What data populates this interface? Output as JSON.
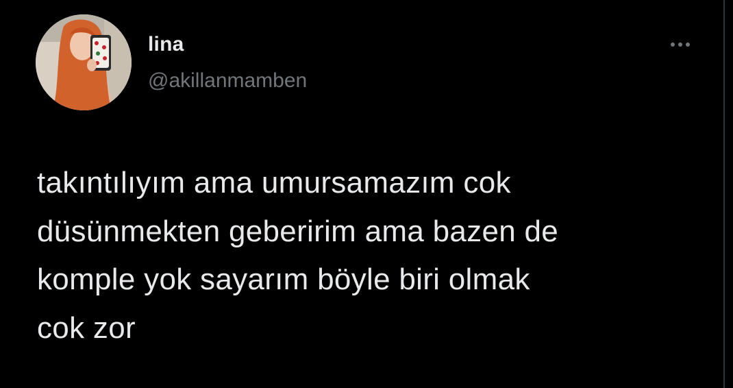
{
  "author": {
    "display_name": "lina",
    "handle": "@akillanmamben",
    "avatar_icon": "profile-photo-avatar"
  },
  "menu": {
    "icon": "more-horizontal-icon"
  },
  "tweet": {
    "text": "takıntılıyım ama umursamazım cok\ndüsünmekten geberirim ama bazen de\nkomple yok sayarım böyle biri olmak\ncok zor"
  },
  "colors": {
    "background": "#000000",
    "primary_text": "#e7e9ea",
    "secondary_text": "#71767b"
  }
}
